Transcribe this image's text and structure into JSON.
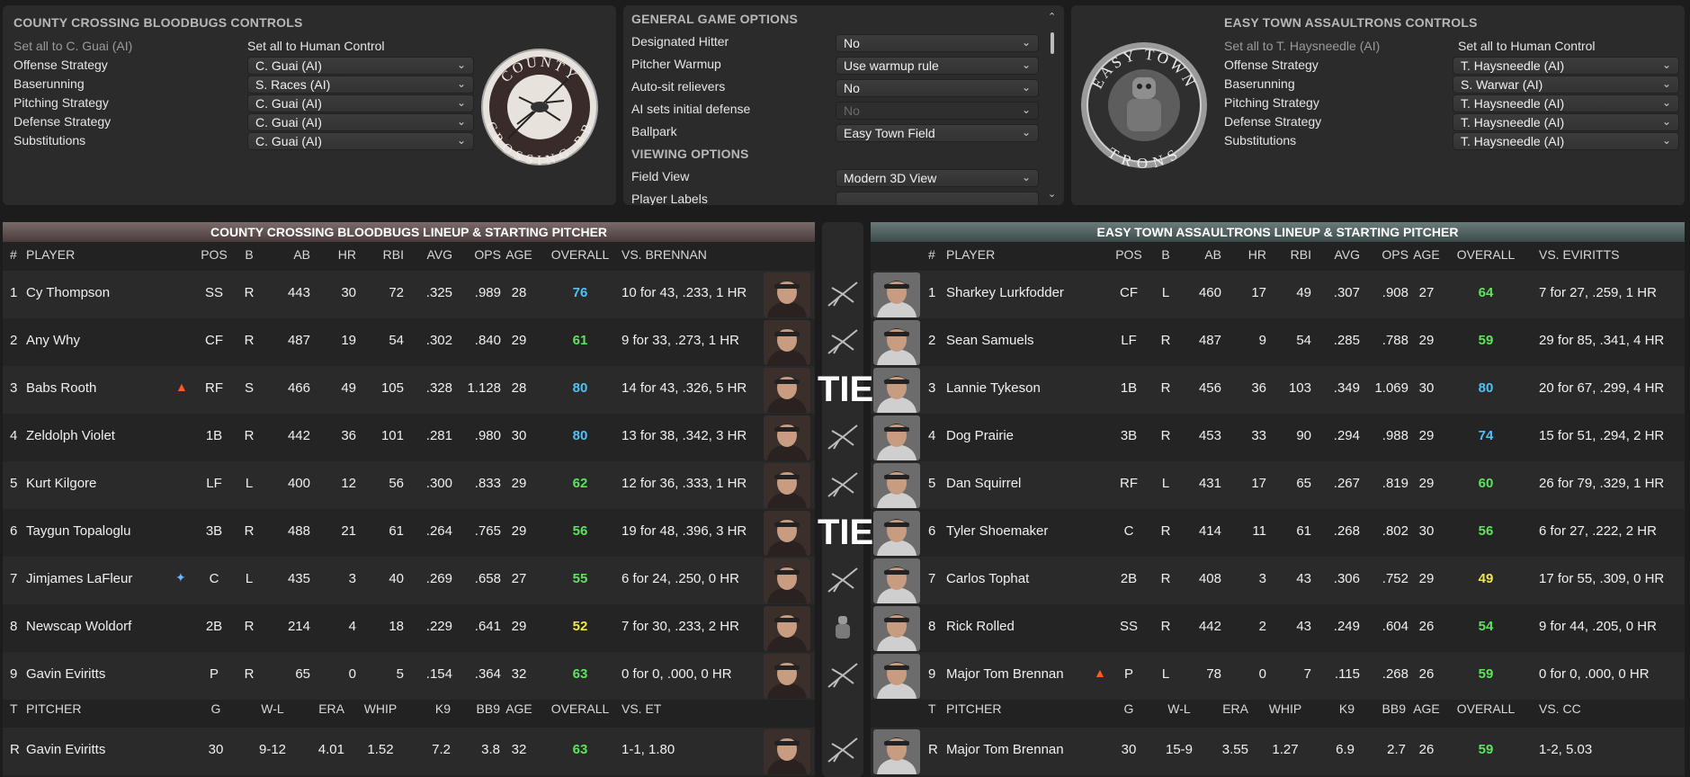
{
  "colors": {
    "blue": "#4fc3f7",
    "green": "#5ee35e",
    "yellow": "#f0e64a",
    "bg": "#1c1c1c",
    "panel": "#2b2b2b"
  },
  "home_controls": {
    "title": "COUNTY CROSSING BLOODBUGS CONTROLS",
    "set_ai": "Set all to C. Guai (AI)",
    "set_human": "Set all to Human Control",
    "rows": [
      {
        "label": "Offense Strategy",
        "value": "C. Guai (AI)"
      },
      {
        "label": "Baserunning",
        "value": "S. Races (AI)"
      },
      {
        "label": "Pitching Strategy",
        "value": "C. Guai (AI)"
      },
      {
        "label": "Defense Strategy",
        "value": "C. Guai (AI)"
      },
      {
        "label": "Substitutions",
        "value": "C. Guai (AI)"
      }
    ],
    "logo_top": "COUNTY",
    "logo_bottom": "CROSSING BB"
  },
  "options": {
    "title": "GENERAL GAME OPTIONS",
    "rows": [
      {
        "label": "Designated Hitter",
        "value": "No",
        "disabled": false
      },
      {
        "label": "Pitcher Warmup",
        "value": "Use warmup rule",
        "disabled": false
      },
      {
        "label": "Auto-sit relievers",
        "value": "No",
        "disabled": false
      },
      {
        "label": "AI sets initial defense",
        "value": "No",
        "disabled": true
      },
      {
        "label": "Ballpark",
        "value": "Easy Town Field",
        "disabled": false
      }
    ],
    "viewing_title": "VIEWING OPTIONS",
    "field_view_label": "Field View",
    "field_view_value": "Modern 3D View",
    "player_labels": "Player Labels"
  },
  "away_controls": {
    "title": "EASY TOWN ASSAULTRONS CONTROLS",
    "set_ai": "Set all to T. Haysneedle (AI)",
    "set_human": "Set all to Human Control",
    "rows": [
      {
        "label": "Offense Strategy",
        "value": "T. Haysneedle (AI)"
      },
      {
        "label": "Baserunning",
        "value": "S. Warwar (AI)"
      },
      {
        "label": "Pitching Strategy",
        "value": "T. Haysneedle (AI)"
      },
      {
        "label": "Defense Strategy",
        "value": "T. Haysneedle (AI)"
      },
      {
        "label": "Substitutions",
        "value": "T. Haysneedle (AI)"
      }
    ],
    "logo_top": "EASY TOWN",
    "logo_bottom": "TRONS"
  },
  "home_lineup": {
    "title": "COUNTY CROSSING BLOODBUGS LINEUP & STARTING PITCHER",
    "headers": [
      "#",
      "PLAYER",
      "POS",
      "B",
      "AB",
      "HR",
      "RBI",
      "AVG",
      "OPS",
      "AGE",
      "OVERALL",
      "VS. BRENNAN"
    ],
    "players": [
      {
        "n": "1",
        "name": "Cy Thompson",
        "icon": "",
        "pos": "SS",
        "b": "R",
        "ab": "443",
        "hr": "30",
        "rbi": "72",
        "avg": ".325",
        "ops": ".989",
        "age": "28",
        "ovr": "76",
        "ovc": "blue",
        "vs": "10 for 43, .233, 1 HR"
      },
      {
        "n": "2",
        "name": "Any Why",
        "icon": "",
        "pos": "CF",
        "b": "R",
        "ab": "487",
        "hr": "19",
        "rbi": "54",
        "avg": ".302",
        "ops": ".840",
        "age": "29",
        "ovr": "61",
        "ovc": "green",
        "vs": "9 for 33, .273, 1 HR"
      },
      {
        "n": "3",
        "name": "Babs Rooth",
        "icon": "fire",
        "pos": "RF",
        "b": "S",
        "ab": "466",
        "hr": "49",
        "rbi": "105",
        "avg": ".328",
        "ops": "1.128",
        "age": "28",
        "ovr": "80",
        "ovc": "blue",
        "vs": "14 for 43, .326, 5 HR"
      },
      {
        "n": "4",
        "name": "Zeldolph Violet",
        "icon": "",
        "pos": "1B",
        "b": "R",
        "ab": "442",
        "hr": "36",
        "rbi": "101",
        "avg": ".281",
        "ops": ".980",
        "age": "30",
        "ovr": "80",
        "ovc": "blue",
        "vs": "13 for 38, .342, 3 HR"
      },
      {
        "n": "5",
        "name": "Kurt Kilgore",
        "icon": "",
        "pos": "LF",
        "b": "L",
        "ab": "400",
        "hr": "12",
        "rbi": "56",
        "avg": ".300",
        "ops": ".833",
        "age": "29",
        "ovr": "62",
        "ovc": "green",
        "vs": "12 for 36, .333, 1 HR"
      },
      {
        "n": "6",
        "name": "Taygun Topaloglu",
        "icon": "",
        "pos": "3B",
        "b": "R",
        "ab": "488",
        "hr": "21",
        "rbi": "61",
        "avg": ".264",
        "ops": ".765",
        "age": "29",
        "ovr": "56",
        "ovc": "green",
        "vs": "19 for 48, .396, 3 HR"
      },
      {
        "n": "7",
        "name": "Jimjames LaFleur",
        "icon": "ice",
        "pos": "C",
        "b": "L",
        "ab": "435",
        "hr": "3",
        "rbi": "40",
        "avg": ".269",
        "ops": ".658",
        "age": "27",
        "ovr": "55",
        "ovc": "green",
        "vs": "6 for 24, .250, 0 HR"
      },
      {
        "n": "8",
        "name": "Newscap Woldorf",
        "icon": "",
        "pos": "2B",
        "b": "R",
        "ab": "214",
        "hr": "4",
        "rbi": "18",
        "avg": ".229",
        "ops": ".641",
        "age": "29",
        "ovr": "52",
        "ovc": "yellow",
        "vs": "7 for 30, .233, 2 HR"
      },
      {
        "n": "9",
        "name": "Gavin Eviritts",
        "icon": "",
        "pos": "P",
        "b": "R",
        "ab": "65",
        "hr": "0",
        "rbi": "5",
        "avg": ".154",
        "ops": ".364",
        "age": "32",
        "ovr": "63",
        "ovc": "green",
        "vs": "0 for 0, .000, 0 HR"
      }
    ],
    "pitcher_headers": [
      "T",
      "PITCHER",
      "G",
      "W-L",
      "ERA",
      "WHIP",
      "K9",
      "BB9",
      "AGE",
      "OVERALL",
      "VS. ET"
    ],
    "pitcher": {
      "t": "R",
      "name": "Gavin Eviritts",
      "g": "30",
      "wl": "9-12",
      "era": "4.01",
      "whip": "1.52",
      "k9": "7.2",
      "bb9": "3.8",
      "age": "32",
      "ovr": "63",
      "vs": "1-1, 1.80"
    }
  },
  "away_lineup": {
    "title": "EASY TOWN ASSAULTRONS LINEUP & STARTING PITCHER",
    "headers": [
      "#",
      "PLAYER",
      "POS",
      "B",
      "AB",
      "HR",
      "RBI",
      "AVG",
      "OPS",
      "AGE",
      "OVERALL",
      "VS. EVIRITTS"
    ],
    "players": [
      {
        "n": "1",
        "name": "Sharkey Lurkfodder",
        "icon": "",
        "pos": "CF",
        "b": "L",
        "ab": "460",
        "hr": "17",
        "rbi": "49",
        "avg": ".307",
        "ops": ".908",
        "age": "27",
        "ovr": "64",
        "ovc": "green",
        "vs": "7 for 27, .259, 1 HR"
      },
      {
        "n": "2",
        "name": "Sean Samuels",
        "icon": "",
        "pos": "LF",
        "b": "R",
        "ab": "487",
        "hr": "9",
        "rbi": "54",
        "avg": ".285",
        "ops": ".788",
        "age": "29",
        "ovr": "59",
        "ovc": "green",
        "vs": "29 for 85, .341, 4 HR"
      },
      {
        "n": "3",
        "name": "Lannie Tykeson",
        "icon": "",
        "pos": "1B",
        "b": "R",
        "ab": "456",
        "hr": "36",
        "rbi": "103",
        "avg": ".349",
        "ops": "1.069",
        "age": "30",
        "ovr": "80",
        "ovc": "blue",
        "vs": "20 for 67, .299, 4 HR"
      },
      {
        "n": "4",
        "name": "Dog Prairie",
        "icon": "",
        "pos": "3B",
        "b": "R",
        "ab": "453",
        "hr": "33",
        "rbi": "90",
        "avg": ".294",
        "ops": ".988",
        "age": "29",
        "ovr": "74",
        "ovc": "blue",
        "vs": "15 for 51, .294, 2 HR"
      },
      {
        "n": "5",
        "name": "Dan Squirrel",
        "icon": "",
        "pos": "RF",
        "b": "L",
        "ab": "431",
        "hr": "17",
        "rbi": "65",
        "avg": ".267",
        "ops": ".819",
        "age": "29",
        "ovr": "60",
        "ovc": "green",
        "vs": "26 for 79, .329, 1 HR"
      },
      {
        "n": "6",
        "name": "Tyler Shoemaker",
        "icon": "",
        "pos": "C",
        "b": "R",
        "ab": "414",
        "hr": "11",
        "rbi": "61",
        "avg": ".268",
        "ops": ".802",
        "age": "30",
        "ovr": "56",
        "ovc": "green",
        "vs": "6 for 27, .222, 2 HR"
      },
      {
        "n": "7",
        "name": "Carlos Tophat",
        "icon": "",
        "pos": "2B",
        "b": "R",
        "ab": "408",
        "hr": "3",
        "rbi": "43",
        "avg": ".306",
        "ops": ".752",
        "age": "29",
        "ovr": "49",
        "ovc": "yellow",
        "vs": "17 for 55, .309, 0 HR"
      },
      {
        "n": "8",
        "name": "Rick Rolled",
        "icon": "",
        "pos": "SS",
        "b": "R",
        "ab": "442",
        "hr": "2",
        "rbi": "43",
        "avg": ".249",
        "ops": ".604",
        "age": "26",
        "ovr": "54",
        "ovc": "green",
        "vs": "9 for 44, .205, 0 HR"
      },
      {
        "n": "9",
        "name": "Major Tom Brennan",
        "icon": "fire",
        "pos": "P",
        "b": "L",
        "ab": "78",
        "hr": "0",
        "rbi": "7",
        "avg": ".115",
        "ops": ".268",
        "age": "26",
        "ovr": "59",
        "ovc": "green",
        "vs": "0 for 0, .000, 0 HR"
      }
    ],
    "pitcher_headers": [
      "T",
      "PITCHER",
      "G",
      "W-L",
      "ERA",
      "WHIP",
      "K9",
      "BB9",
      "AGE",
      "OVERALL",
      "VS. CC"
    ],
    "pitcher": {
      "t": "R",
      "name": "Major Tom Brennan",
      "g": "30",
      "wl": "15-9",
      "era": "3.55",
      "whip": "1.27",
      "k9": "6.9",
      "bb9": "2.7",
      "age": "26",
      "ovr": "59",
      "vs": "1-2, 5.03"
    }
  },
  "matchups": [
    "home",
    "home",
    "tie",
    "home",
    "home",
    "tie",
    "home",
    "away",
    "home"
  ],
  "tie_label": "TIE"
}
